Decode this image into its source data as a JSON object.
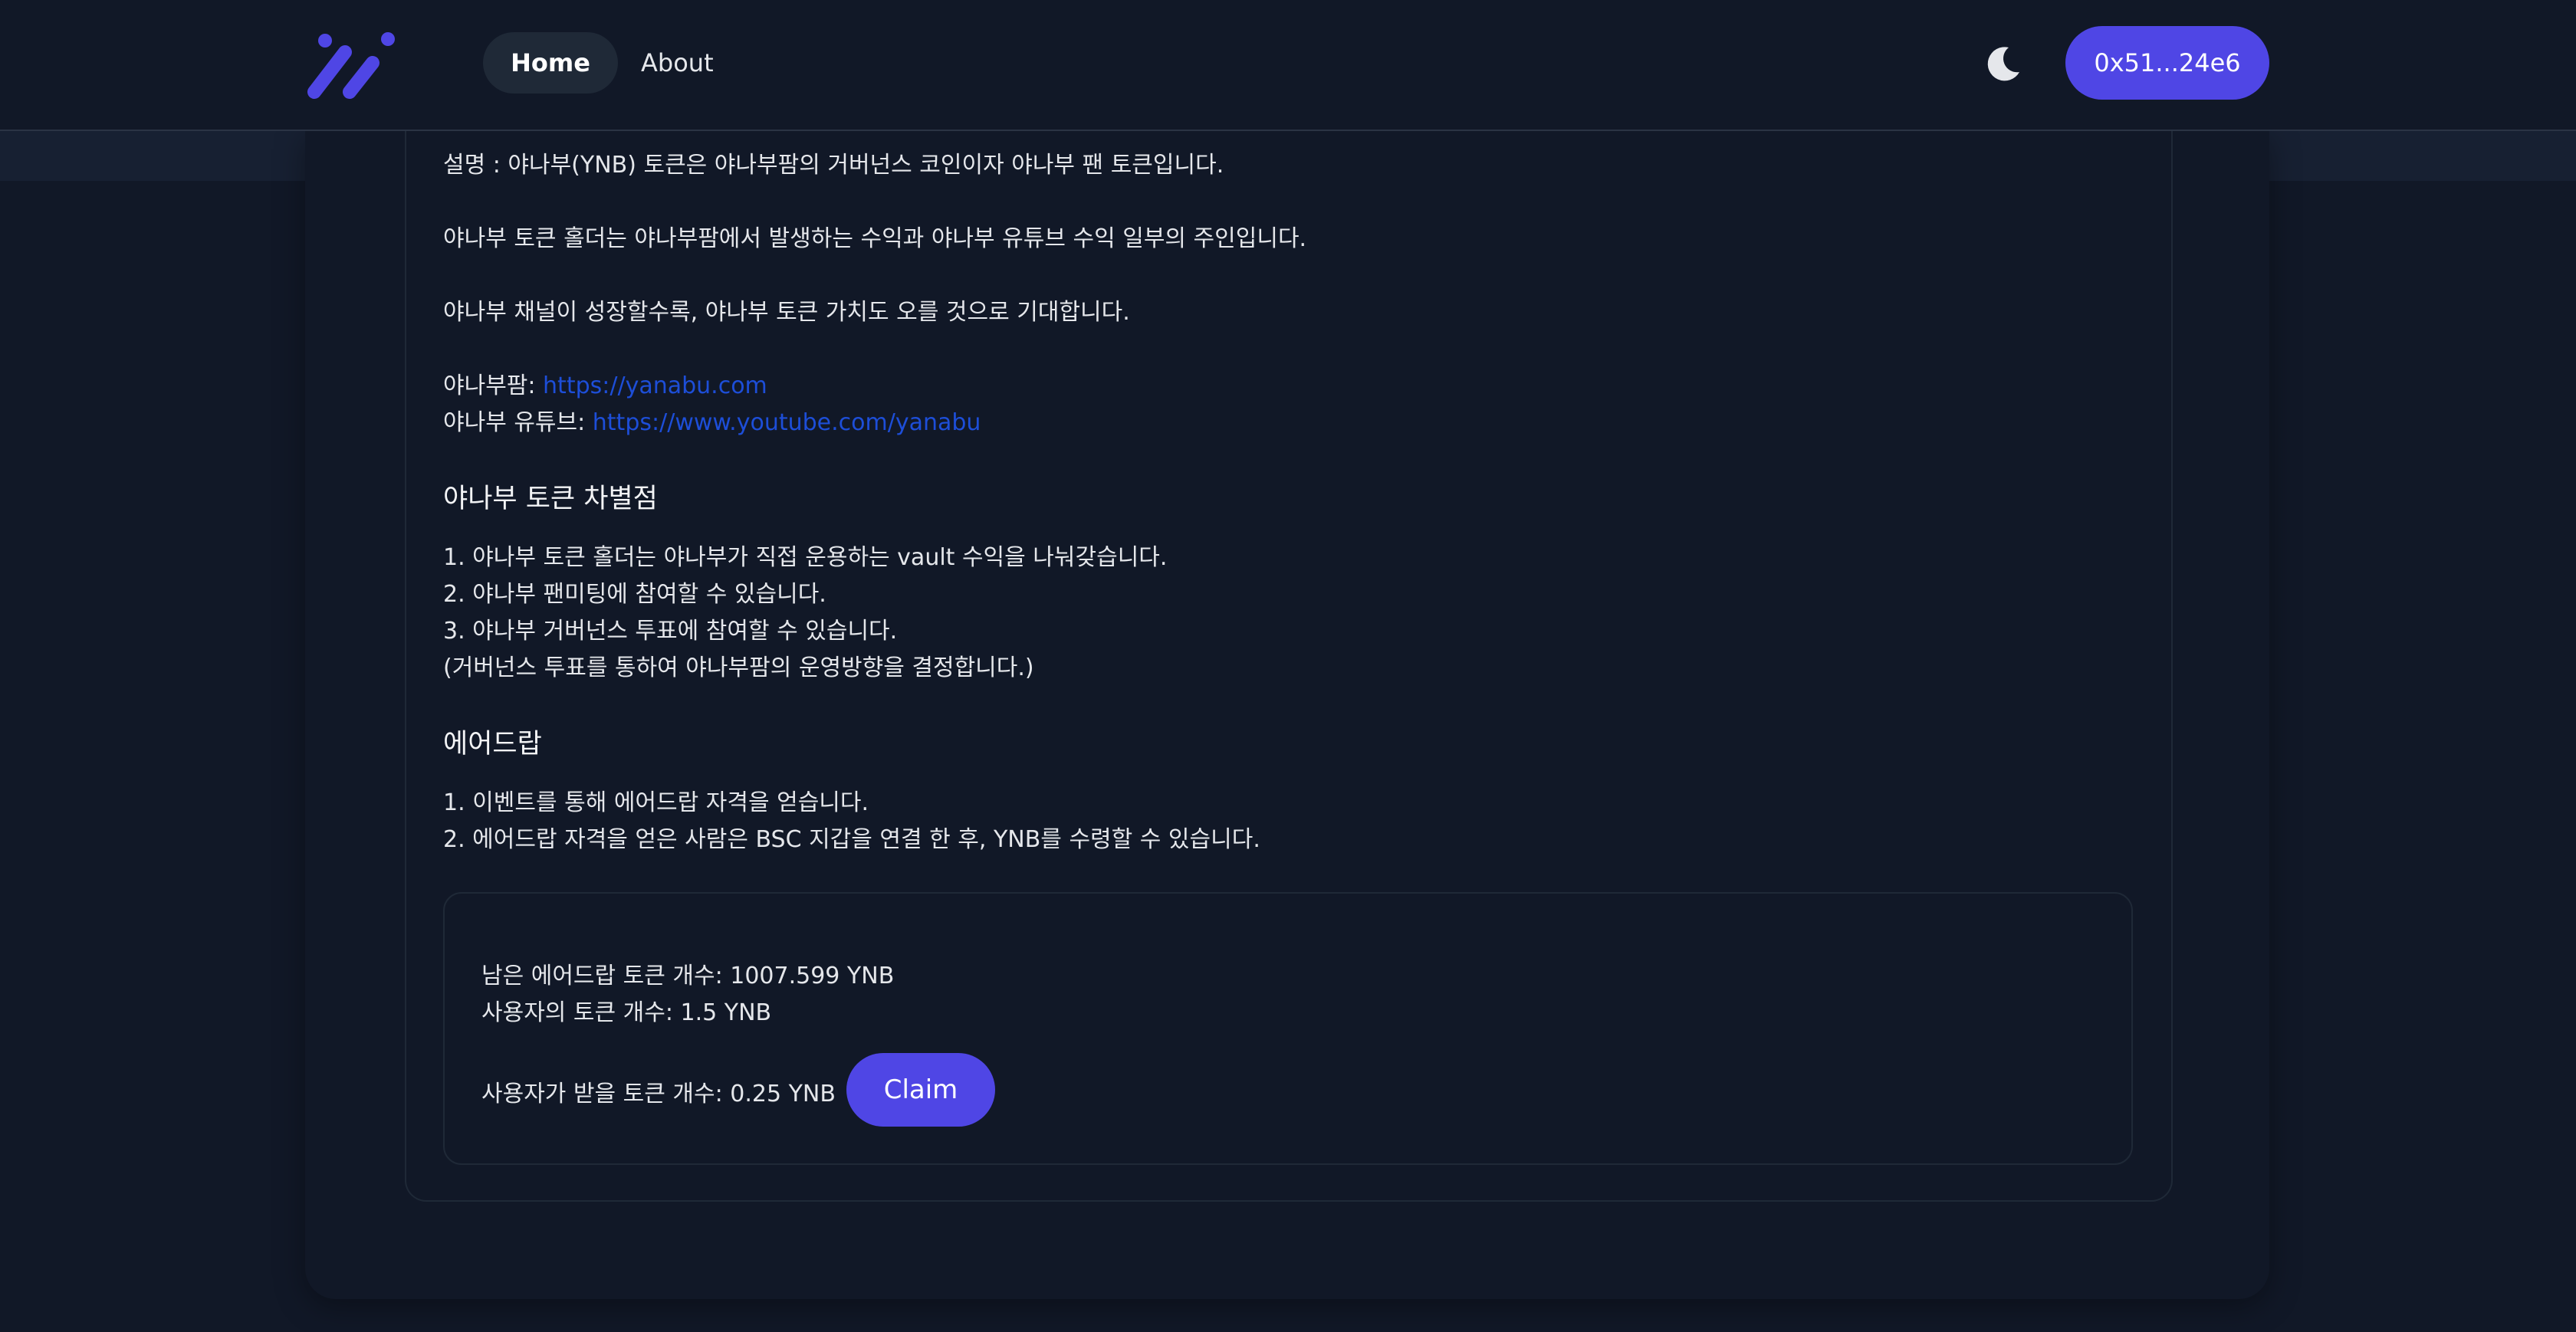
{
  "header": {
    "logo_icon": "brand-logo-icon",
    "nav": [
      {
        "label": "Home",
        "active": true
      },
      {
        "label": "About",
        "active": false
      }
    ],
    "theme_icon": "moon-icon",
    "wallet_label": "0x51...24e6"
  },
  "content": {
    "desc_lines": [
      "설명 : 야나부(YNB) 토큰은 야나부팜의 거버넌스 코인이자 야나부 팬 토큰입니다.",
      "야나부 토큰 홀더는 야나부팜에서 발생하는 수익과 야나부 유튜브 수익 일부의 주인입니다.",
      "야나부 채널이 성장할수록, 야나부 토큰 가치도 오를 것으로 기대합니다."
    ],
    "links": [
      {
        "label": "야나부팜: ",
        "url": "https://yanabu.com"
      },
      {
        "label": "야나부 유튜브: ",
        "url": "https://www.youtube.com/yanabu"
      }
    ],
    "features_heading": "야나부 토큰 차별점",
    "features": [
      "1. 야나부 토큰 홀더는 야나부가 직접 운용하는 vault 수익을 나눠갖습니다.",
      "2. 야나부 팬미팅에 참여할 수 있습니다.",
      "3. 야나부 거버넌스 투표에 참여할 수 있습니다.",
      "(거버넌스 투표를 통하여 야나부팜의 운영방향을 결정합니다.)"
    ],
    "airdrop_heading": "에어드랍",
    "airdrop_lines": [
      "1. 이벤트를 통해 에어드랍 자격을 얻습니다.",
      "2. 에어드랍 자격을 얻은 사람은 BSC 지갑을 연결 한 후, YNB를 수령할 수 있습니다."
    ]
  },
  "airdrop_box": {
    "remaining": "남은 에어드랍 토큰 개수: 1007.599 YNB",
    "user_tokens": "사용자의 토큰 개수: 1.5 YNB",
    "claimable": "사용자가 받을 토큰 개수: 0.25 YNB",
    "claim_label": "Claim"
  },
  "colors": {
    "background": "#111827",
    "accent": "#4f46e5",
    "link": "#1d4ed8"
  }
}
